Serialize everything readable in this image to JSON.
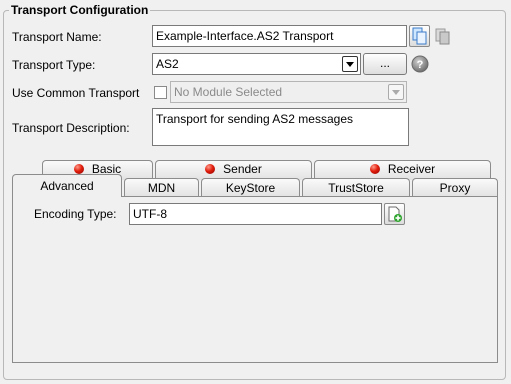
{
  "group": {
    "title": "Transport Configuration"
  },
  "form": {
    "name_label": "Transport Name:",
    "name_value": "Example-Interface.AS2 Transport",
    "type_label": "Transport Type:",
    "type_value": "AS2",
    "type_button": "...",
    "common_label": "Use Common Transport",
    "common_checked": false,
    "common_value": "No Module Selected",
    "desc_label": "Transport Description:",
    "desc_value": "Transport for sending AS2 messages"
  },
  "tabs_top": [
    {
      "label": "Basic",
      "status": "error"
    },
    {
      "label": "Sender",
      "status": "error"
    },
    {
      "label": "Receiver",
      "status": "error"
    }
  ],
  "tabs_bottom": [
    {
      "label": "Advanced",
      "active": true
    },
    {
      "label": "MDN"
    },
    {
      "label": "KeyStore"
    },
    {
      "label": "TrustStore"
    },
    {
      "label": "Proxy"
    }
  ],
  "advanced": {
    "encoding_label": "Encoding Type:",
    "encoding_value": "UTF-8"
  },
  "colors": {
    "status_error": "#e11d0c",
    "background": "#f0f0f0"
  },
  "icons": [
    "copy-icon",
    "copy-disabled-icon",
    "help-icon",
    "add-document-icon"
  ]
}
